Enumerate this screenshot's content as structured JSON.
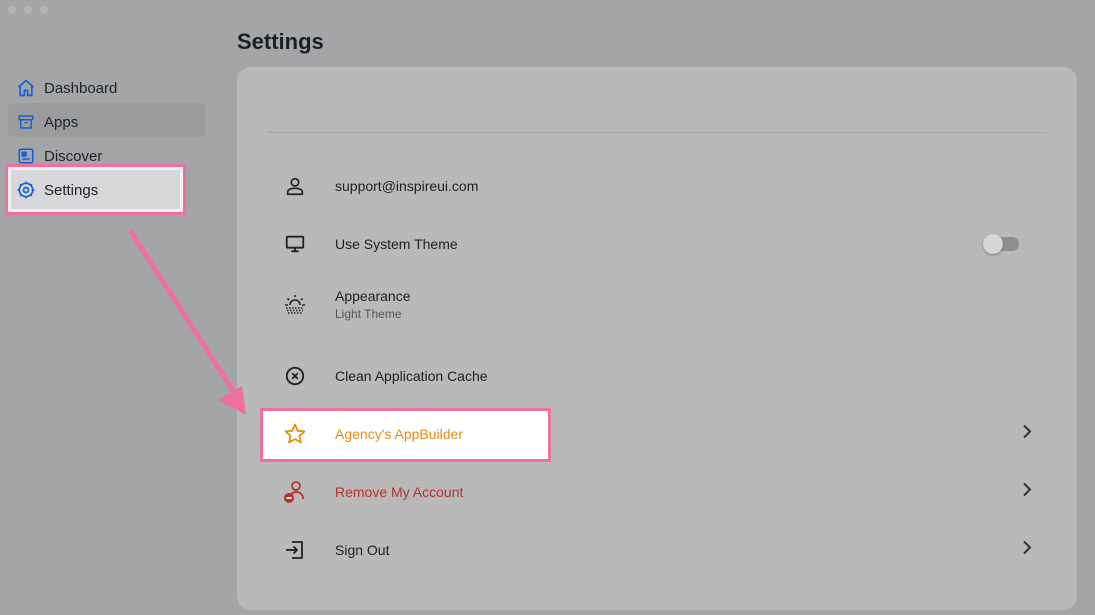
{
  "page": {
    "title": "Settings"
  },
  "sidebar": {
    "items": [
      {
        "label": "Dashboard",
        "icon": "home-icon"
      },
      {
        "label": "Apps",
        "icon": "archive-box-icon"
      },
      {
        "label": "Discover",
        "icon": "newspaper-icon"
      },
      {
        "label": "Settings",
        "icon": "gear-icon",
        "active": true
      }
    ]
  },
  "settings": {
    "rows": [
      {
        "label": "support@inspireui.com",
        "icon": "user-icon"
      },
      {
        "label": "Use System Theme",
        "icon": "monitor-icon",
        "toggle": false
      },
      {
        "label": "Appearance",
        "sublabel": "Light Theme",
        "icon": "sun-haze-icon"
      },
      {
        "label": "Clean Application Cache",
        "icon": "circle-x-icon"
      },
      {
        "label": "Agency's AppBuilder",
        "icon": "star-icon",
        "color": "#e58d0e"
      },
      {
        "label": "Remove My Account",
        "icon": "remove-user-icon",
        "color": "#b4332a"
      },
      {
        "label": "Sign Out",
        "icon": "sign-out-icon"
      }
    ]
  },
  "colors": {
    "highlight": "#f06fa0",
    "accent_blue": "#1a5fd1"
  }
}
